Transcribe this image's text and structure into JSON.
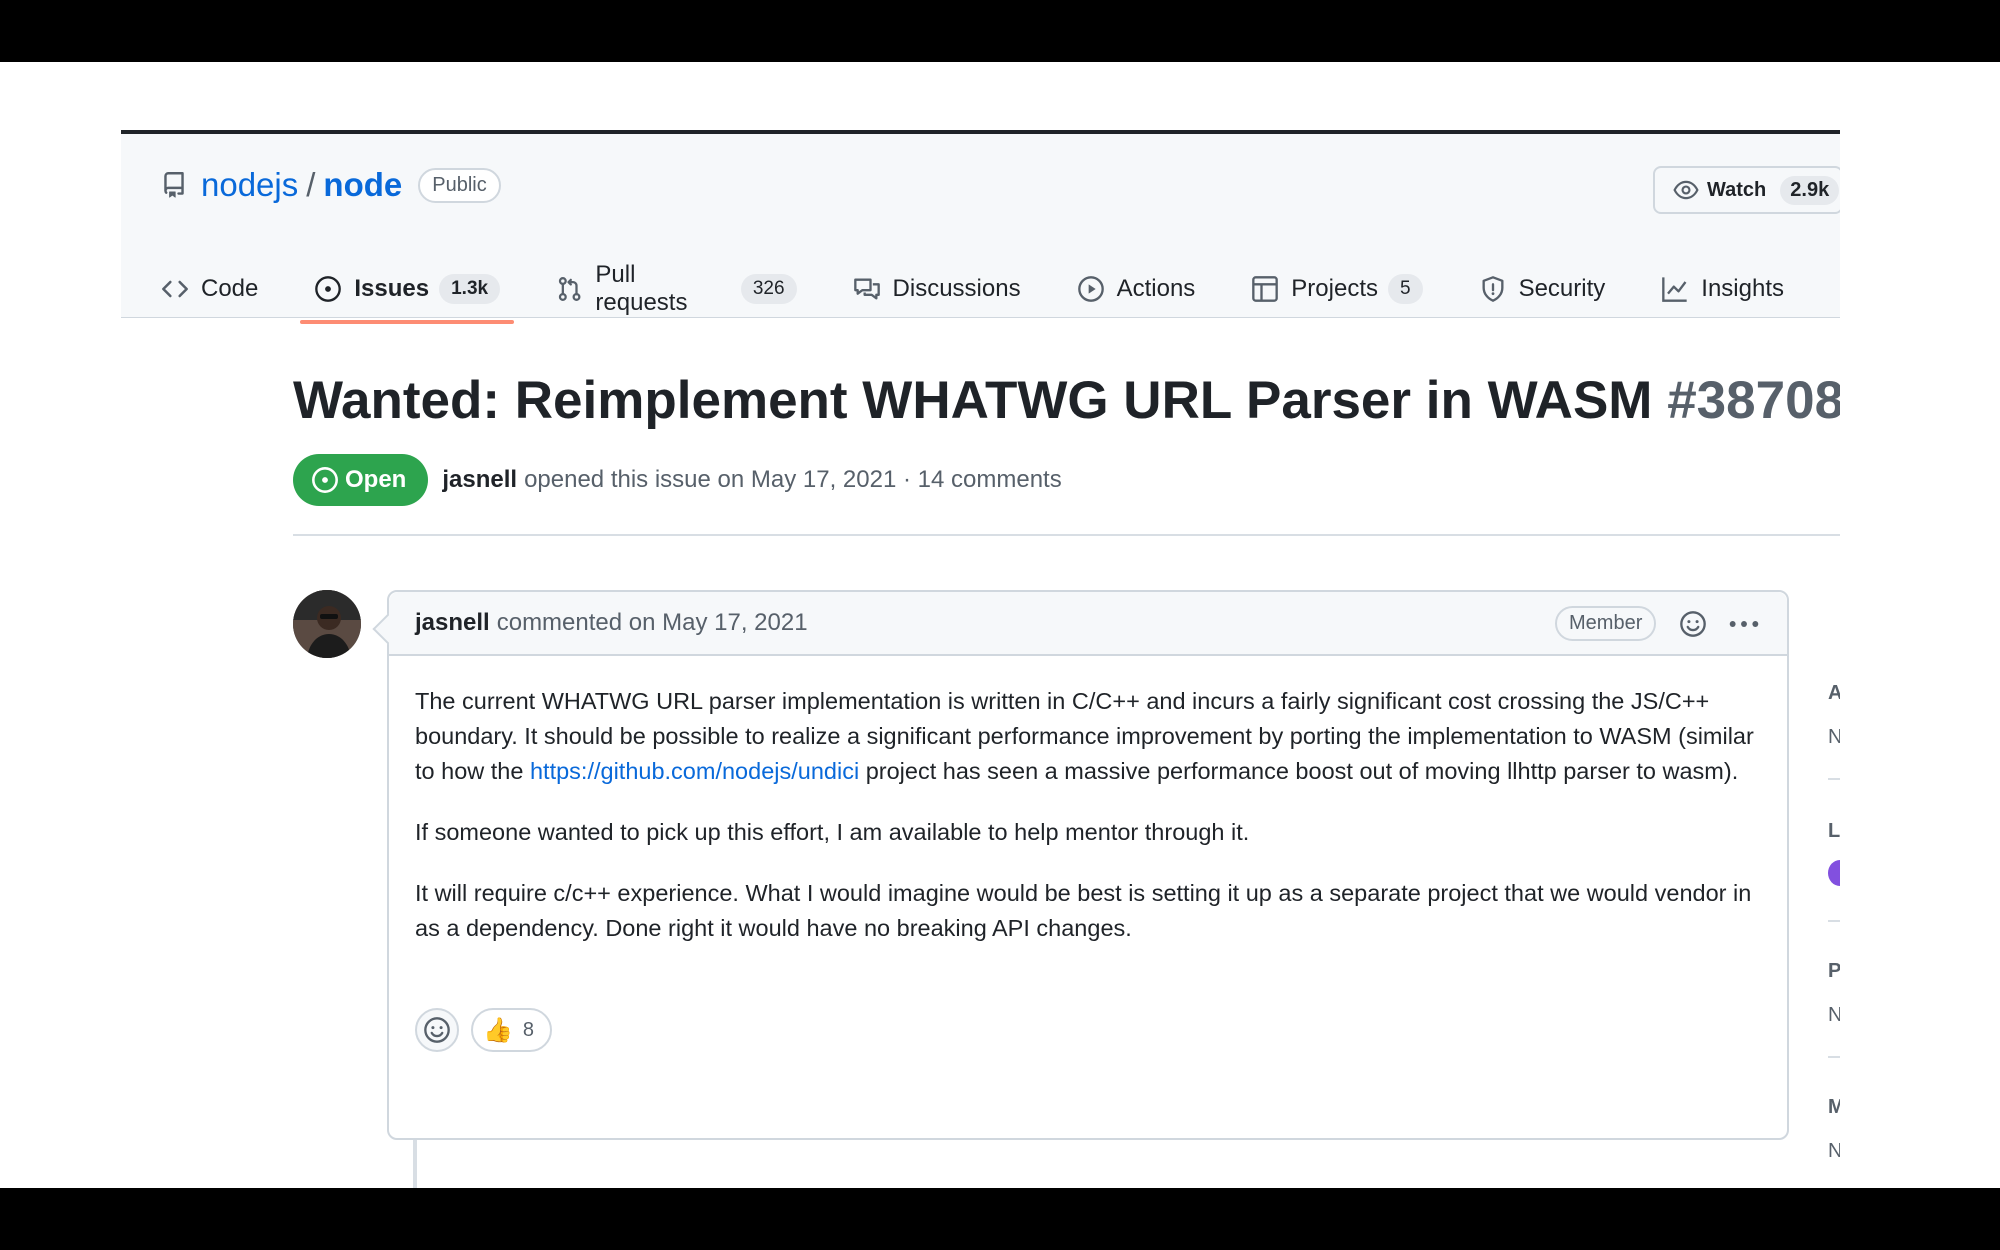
{
  "repo": {
    "owner": "nodejs",
    "separator": "/",
    "name": "node",
    "visibility": "Public",
    "watch_label": "Watch",
    "watch_count": "2.9k"
  },
  "tabs": [
    {
      "label": "Code",
      "icon": "code-icon",
      "count": null
    },
    {
      "label": "Issues",
      "icon": "issue-opened-icon",
      "count": "1.3k",
      "active": true
    },
    {
      "label": "Pull requests",
      "icon": "git-pull-request-icon",
      "count": "326"
    },
    {
      "label": "Discussions",
      "icon": "comment-discussion-icon",
      "count": null
    },
    {
      "label": "Actions",
      "icon": "play-icon",
      "count": null
    },
    {
      "label": "Projects",
      "icon": "table-icon",
      "count": "5"
    },
    {
      "label": "Security",
      "icon": "shield-icon",
      "count": null
    },
    {
      "label": "Insights",
      "icon": "graph-icon",
      "count": null
    }
  ],
  "issue": {
    "title": "Wanted: Reimplement WHATWG URL Parser in WASM",
    "number": "#38708",
    "state": "Open",
    "author": "jasnell",
    "meta": "opened this issue on May 17, 2021 · 14 comments"
  },
  "comment": {
    "author": "jasnell",
    "meta": "commented on May 17, 2021",
    "role": "Member",
    "p1_before": "The current WHATWG URL parser implementation is written in C/C++ and incurs a fairly significant cost crossing the JS/C++ boundary. It should be possible to realize a significant performance improvement by porting the implementation to WASM (similar to how the ",
    "p1_link": "https://github.com/nodejs/undici",
    "p1_after": " project has seen a massive performance boost out of moving llhttp parser to wasm).",
    "p2": "If someone wanted to pick up this effort, I am available to help mentor through it.",
    "p3": "It will require c/c++ experience. What I would imagine would be best is setting it up as a separate project that we would vendor in as a dependency. Done right it would have no breaking API changes.",
    "reaction_emoji": "👍",
    "reaction_count": "8"
  },
  "sidebar": {
    "letters": [
      "A",
      "N",
      "L",
      "P",
      "N",
      "M",
      "N"
    ]
  },
  "colors": {
    "open_green": "#2da44e",
    "link_blue": "#0969da",
    "active_tab_underline": "#fd8c73",
    "label_purple": "#8250df"
  }
}
